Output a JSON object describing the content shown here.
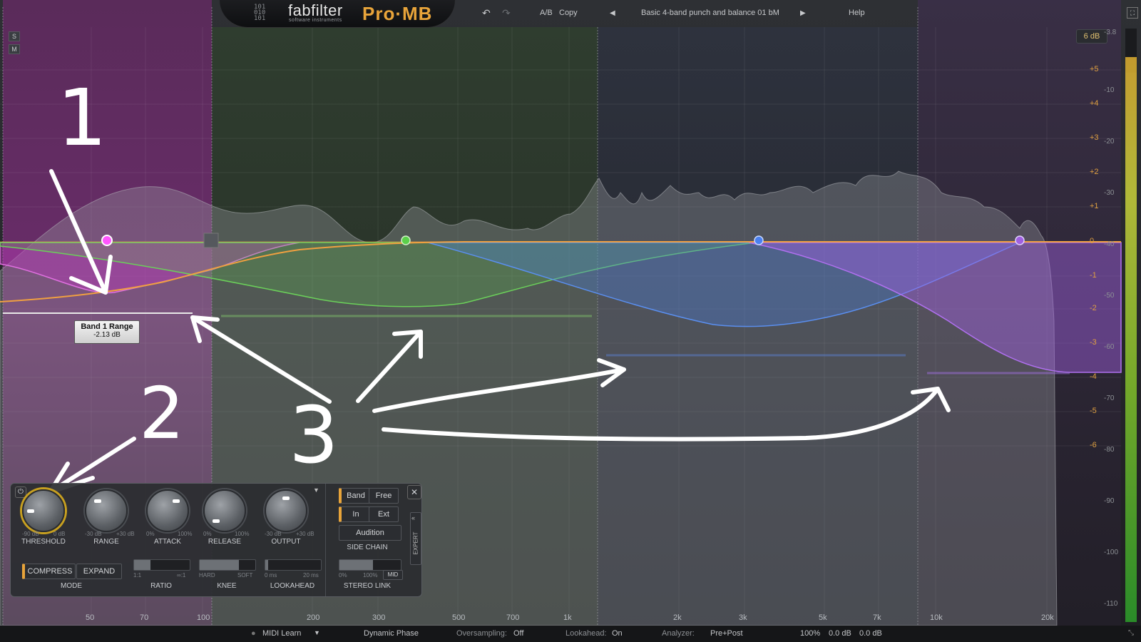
{
  "app": {
    "brand": "fabfilter",
    "brand_sub": "software instruments",
    "product": "Pro·MB"
  },
  "toolbar": {
    "undo_icon": "undo-icon",
    "redo_icon": "redo-icon",
    "ab_label": "A/B",
    "copy_label": "Copy",
    "preset_name": "Basic 4-band punch and balance 01 bM",
    "help_label": "Help"
  },
  "side_buttons": {
    "solo": "S",
    "mute": "M"
  },
  "display_range": "6 dB",
  "gain_scale": [
    "+5",
    "+4",
    "+3",
    "+2",
    "+1",
    "0",
    "-1",
    "-2",
    "-3",
    "-4",
    "-5",
    "-6"
  ],
  "meter_scale": [
    "-3.8",
    "-10",
    "-20",
    "-30",
    "-40",
    "-50",
    "-60",
    "-70",
    "-80",
    "-90",
    "-100",
    "-110"
  ],
  "freq_scale": [
    "50",
    "70",
    "100",
    "200",
    "300",
    "500",
    "700",
    "1k",
    "2k",
    "3k",
    "5k",
    "7k",
    "10k",
    "20k"
  ],
  "tooltip": {
    "title": "Band 1 Range",
    "value": "-2.13 dB"
  },
  "annotations": {
    "n1": "1",
    "n2": "2",
    "n3": "3"
  },
  "band_colors": {
    "band1": "#d646d6",
    "band2": "#5bc04a",
    "band3": "#4a7fe0",
    "band4": "#a060e0",
    "output_curve": "#f0a040"
  },
  "panel": {
    "knobs": [
      {
        "name": "THRESHOLD",
        "min": "-90 dB",
        "max": "0 dB"
      },
      {
        "name": "RANGE",
        "min": "-30 dB",
        "max": "+30 dB"
      },
      {
        "name": "ATTACK",
        "min": "0%",
        "max": "100%"
      },
      {
        "name": "RELEASE",
        "min": "0%",
        "max": "100%"
      },
      {
        "name": "OUTPUT",
        "min": "-30 dB",
        "max": "+30 dB"
      }
    ],
    "mode": {
      "label": "MODE",
      "compress": "COMPRESS",
      "expand": "EXPAND"
    },
    "ratio": {
      "label": "RATIO",
      "min": "1:1",
      "max": "∞:1",
      "value": 0.3
    },
    "knee": {
      "label": "KNEE",
      "min": "HARD",
      "max": "SOFT",
      "value": 0.7
    },
    "lookahead": {
      "label": "LOOKAHEAD",
      "min": "0 ms",
      "max": "20 ms",
      "value": 0.05
    },
    "sidechain": {
      "band": "Band",
      "free": "Free",
      "in": "In",
      "ext": "Ext",
      "audition": "Audition",
      "label": "SIDE CHAIN"
    },
    "stereo_link": {
      "label": "STEREO LINK",
      "min": "0%",
      "max": "100%",
      "mid": "MID",
      "value": 0.55
    },
    "expert": "EXPERT"
  },
  "status": {
    "midi_learn": "MIDI Learn",
    "dynamic_phase": "Dynamic Phase",
    "oversampling_label": "Oversampling:",
    "oversampling_value": "Off",
    "lookahead_label": "Lookahead:",
    "lookahead_value": "On",
    "analyzer_label": "Analyzer:",
    "analyzer_value": "Pre+Post",
    "zoom": "100%",
    "gain1": "0.0 dB",
    "gain2": "0.0 dB"
  }
}
